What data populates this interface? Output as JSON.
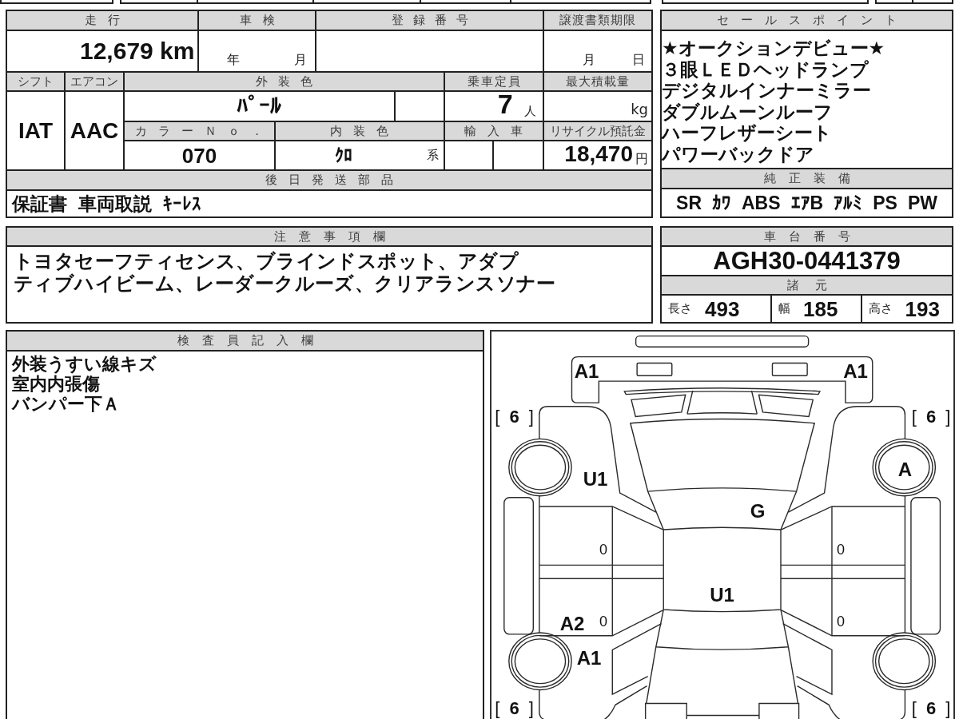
{
  "vehicle": {
    "mileage": {
      "label": "走行",
      "value": "12,679 km"
    },
    "inspection": {
      "label": "車検",
      "year": "年",
      "month": "月"
    },
    "registration_no": {
      "label": "登録番号"
    },
    "transfer_deadline": {
      "label": "譲渡書類期限",
      "month": "月",
      "day": "日"
    },
    "shift": {
      "label": "シフト",
      "value": "IAT"
    },
    "aircon": {
      "label": "エアコン",
      "value": "AAC"
    },
    "exterior_color": {
      "label": "外装色",
      "value": "ﾊﾟｰﾙ"
    },
    "seating": {
      "label": "乗車定員",
      "value": "7",
      "unit": "人"
    },
    "max_load": {
      "label": "最大積載量",
      "unit": "kg"
    },
    "color_no": {
      "label": "カラーＮｏ．",
      "value": "070"
    },
    "interior_color": {
      "label": "内装色",
      "value": "ｸﾛ",
      "suffix": "系"
    },
    "imported": {
      "label": "輸入車"
    },
    "recycle_deposit": {
      "label": "リサイクル預託金",
      "value": "18,470",
      "unit": "円"
    },
    "later_parts": {
      "label": "後日発送部品",
      "items": [
        "保証書",
        "車両取説",
        "ｷｰﾚｽ"
      ]
    }
  },
  "sales_points": {
    "title": "セールスポイント",
    "items": [
      "★オークションデビュー★",
      "３眼ＬＥＤヘッドランプ",
      "デジタルインナーミラー",
      "ダブルムーンルーフ",
      "ハーフレザーシート",
      "パワーバックドア"
    ]
  },
  "equipment": {
    "title": "純正装備",
    "items": [
      "SR",
      "ｶﾜ",
      "ABS",
      "ｴｱB",
      "ｱﾙﾐ",
      "PS",
      "PW"
    ]
  },
  "notes": {
    "title": "注意事項欄",
    "lines": [
      "トヨタセーフティセンス、ブラインドスポット、アダプ",
      "ティブハイビーム、レーダークルーズ、クリアランスソナー"
    ]
  },
  "chassis": {
    "title": "車台番号",
    "number": "AGH30-0441379",
    "specs_title": "諸元",
    "specs": [
      {
        "label": "長さ",
        "value": "493"
      },
      {
        "label": "幅",
        "value": "185"
      },
      {
        "label": "高さ",
        "value": "193"
      }
    ]
  },
  "inspector": {
    "title": "検査員記入欄",
    "lines": [
      "外装うすい線キズ",
      "室内内張傷",
      "バンパー下Ａ"
    ]
  },
  "diagram": {
    "marks": [
      {
        "kind": "code",
        "text": "A1"
      },
      {
        "kind": "code",
        "text": "A1"
      },
      {
        "kind": "tread",
        "text": "[ **6** ]"
      },
      {
        "kind": "tread",
        "text": "[ **6** ]"
      },
      {
        "kind": "code",
        "text": "A"
      },
      {
        "kind": "code",
        "text": "U1"
      },
      {
        "kind": "code",
        "text": "G"
      },
      {
        "kind": "door",
        "text": "0"
      },
      {
        "kind": "door",
        "text": "0"
      },
      {
        "kind": "code",
        "text": "U1"
      },
      {
        "kind": "code",
        "text": "A2"
      },
      {
        "kind": "door",
        "text": "0"
      },
      {
        "kind": "door",
        "text": "0"
      },
      {
        "kind": "code",
        "text": "A1"
      },
      {
        "kind": "tread",
        "text": "[ **6** ]"
      },
      {
        "kind": "tread",
        "text": "[ **6** ]"
      }
    ]
  }
}
